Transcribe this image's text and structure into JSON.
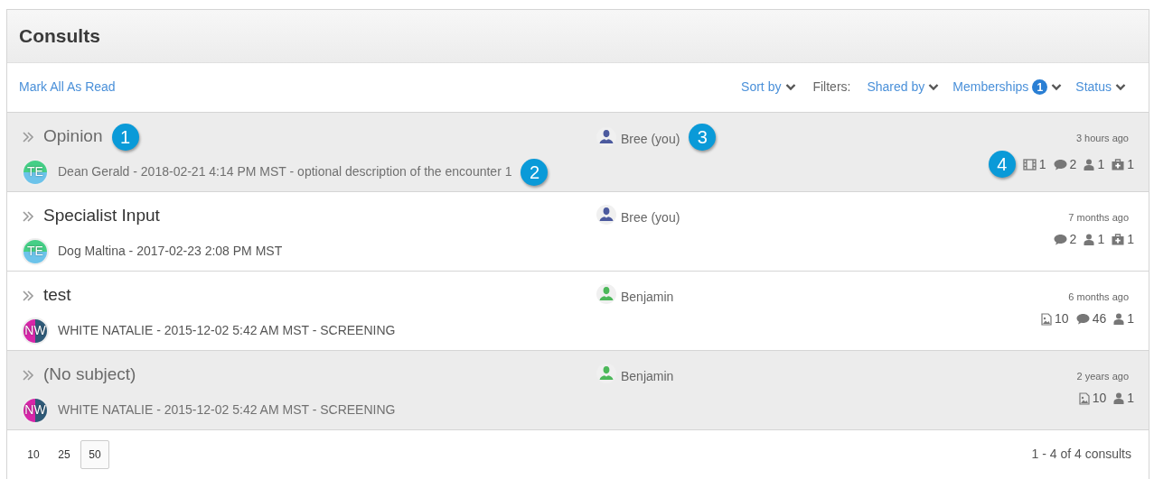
{
  "title": "Consults",
  "toolbar": {
    "mark_all": "Mark All As Read",
    "sort": "Sort by",
    "filters_label": "Filters:",
    "filters": [
      {
        "label": "Shared by"
      },
      {
        "label": "Memberships",
        "badge": "1"
      },
      {
        "label": "Status"
      }
    ]
  },
  "consults": [
    {
      "subject": "Opinion",
      "shaded": true,
      "subject_callout": "1",
      "avatar": {
        "initials": "TE",
        "kind": "horizontal"
      },
      "meta": "Dean Gerald - 2018-02-21 4:14 PM MST - optional description of the encounter 1",
      "meta_callout": "2",
      "shared_by": {
        "name": "Bree",
        "suffix": "(you)",
        "color": "#4c5a9e"
      },
      "shared_callout": "3",
      "time": "3 hours ago",
      "stats_callout": "4",
      "stats": [
        {
          "kind": "film",
          "count": "1"
        },
        {
          "kind": "comment",
          "count": "2"
        },
        {
          "kind": "person",
          "count": "1"
        },
        {
          "kind": "medkit",
          "count": "1"
        }
      ]
    },
    {
      "subject": "Specialist Input",
      "shaded": false,
      "avatar": {
        "initials": "TE",
        "kind": "horizontal"
      },
      "meta": "Dog Maltina - 2017-02-23 2:08 PM MST",
      "shared_by": {
        "name": "Bree",
        "suffix": "(you)",
        "color": "#4c5a9e"
      },
      "time": "7 months ago",
      "stats": [
        {
          "kind": "comment",
          "count": "2"
        },
        {
          "kind": "person",
          "count": "1"
        },
        {
          "kind": "medkit",
          "count": "1"
        }
      ]
    },
    {
      "subject": "test",
      "shaded": false,
      "avatar": {
        "initials": "NW",
        "kind": "vertical"
      },
      "meta": "WHITE NATALIE - 2015-12-02 5:42 AM MST - SCREENING",
      "shared_by": {
        "name": "Benjamin",
        "color": "#4cb85a"
      },
      "time": "6 months ago",
      "stats": [
        {
          "kind": "image",
          "count": "10"
        },
        {
          "kind": "comment",
          "count": "46"
        },
        {
          "kind": "person",
          "count": "1"
        }
      ]
    },
    {
      "subject": "(No subject)",
      "shaded": true,
      "avatar": {
        "initials": "NW",
        "kind": "vertical"
      },
      "meta": "WHITE NATALIE - 2015-12-02 5:42 AM MST - SCREENING",
      "shared_by": {
        "name": "Benjamin",
        "color": "#4cb85a"
      },
      "time": "2 years ago",
      "stats": [
        {
          "kind": "image",
          "count": "10"
        },
        {
          "kind": "person",
          "count": "1"
        }
      ]
    }
  ],
  "page_sizes": [
    {
      "label": "10",
      "selected": false
    },
    {
      "label": "25",
      "selected": false
    },
    {
      "label": "50",
      "selected": true
    }
  ],
  "summary": "1 - 4 of 4 consults"
}
